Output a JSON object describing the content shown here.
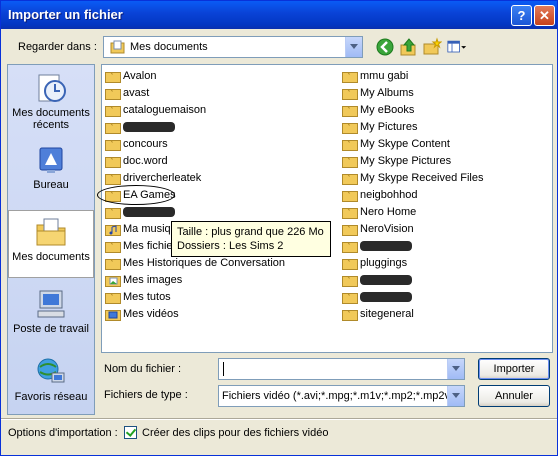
{
  "window": {
    "title": "Importer un fichier",
    "help": "?",
    "close": "✕"
  },
  "lookin": {
    "label": "Regarder dans :",
    "value": "Mes documents"
  },
  "places": [
    {
      "label": "Mes documents récents",
      "icon": "recent-documents-icon"
    },
    {
      "label": "Bureau",
      "icon": "desktop-icon"
    },
    {
      "label": "Mes documents",
      "icon": "my-documents-icon"
    },
    {
      "label": "Poste de travail",
      "icon": "my-computer-icon"
    },
    {
      "label": "Favoris réseau",
      "icon": "network-places-icon"
    }
  ],
  "files_left": [
    {
      "name": "Avalon",
      "kind": "folder"
    },
    {
      "name": "avast",
      "kind": "folder"
    },
    {
      "name": "cataloguemaison",
      "kind": "folder"
    },
    {
      "name": "",
      "kind": "folder",
      "redacted": true
    },
    {
      "name": "concours",
      "kind": "folder"
    },
    {
      "name": "doc.word",
      "kind": "folder"
    },
    {
      "name": "drivercherleatek",
      "kind": "folder"
    },
    {
      "name": "EA Games",
      "kind": "folder"
    },
    {
      "name": "",
      "kind": "folder",
      "redacted": true
    },
    {
      "name": "Ma musique",
      "kind": "music"
    },
    {
      "name": "Mes fichiers",
      "kind": "folder"
    },
    {
      "name": "Mes Historiques de Conversation",
      "kind": "folder"
    },
    {
      "name": "Mes images",
      "kind": "pictures"
    },
    {
      "name": "Mes tutos",
      "kind": "folder"
    },
    {
      "name": "Mes vidéos",
      "kind": "video"
    }
  ],
  "files_right": [
    {
      "name": "mmu gabi",
      "kind": "folder"
    },
    {
      "name": "My Albums",
      "kind": "folder"
    },
    {
      "name": "My eBooks",
      "kind": "folder"
    },
    {
      "name": "My Pictures",
      "kind": "folder"
    },
    {
      "name": "My Skype Content",
      "kind": "folder"
    },
    {
      "name": "My Skype Pictures",
      "kind": "folder"
    },
    {
      "name": "My Skype Received Files",
      "kind": "folder"
    },
    {
      "name": "neigbohhod",
      "kind": "folder"
    },
    {
      "name": "Nero Home",
      "kind": "folder"
    },
    {
      "name": "NeroVision",
      "kind": "folder"
    },
    {
      "name": "",
      "kind": "folder",
      "redacted": true
    },
    {
      "name": "pluggings",
      "kind": "folder"
    },
    {
      "name": "",
      "kind": "folder",
      "redacted": true
    },
    {
      "name": "",
      "kind": "folder",
      "redacted": true
    },
    {
      "name": "sitegeneral",
      "kind": "folder"
    }
  ],
  "tooltip": {
    "line1": "Taille : plus grand que 226 Mo",
    "line2": "Dossiers : Les Sims 2"
  },
  "filename": {
    "label": "Nom du fichier :",
    "value": ""
  },
  "filetype": {
    "label": "Fichiers de type :",
    "value": "Fichiers vidéo (*.avi;*.mpg;*.m1v;*.mp2;*.mp2v;"
  },
  "buttons": {
    "import": "Importer",
    "cancel": "Annuler"
  },
  "options": {
    "label": "Options d'importation :",
    "checkbox_label": "Créer des clips pour des fichiers vidéo",
    "checked": true
  },
  "colors": {
    "titlebar": "#0a44d8",
    "folder": "#f1c959",
    "tooltip": "#ffffe1"
  }
}
